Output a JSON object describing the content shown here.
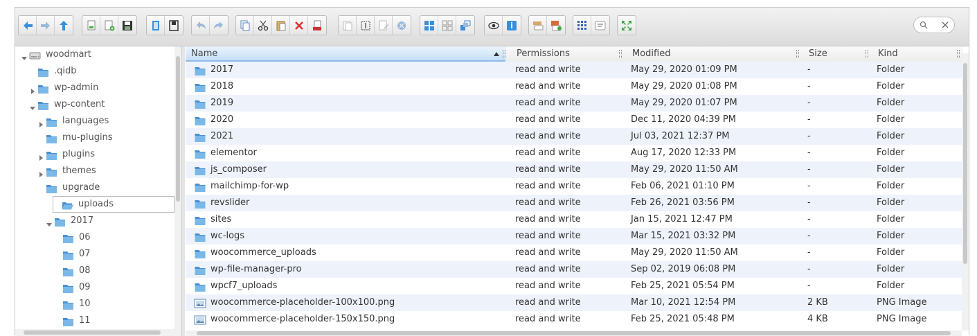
{
  "colors": {
    "folder": "#7ab8e8",
    "folder_dark": "#4a90d2",
    "accent": "#3a8fd8",
    "row_alt": "#eef3fb"
  },
  "toolbar": {
    "groups": [
      {
        "buttons": [
          "back-icon",
          "forward-icon",
          "up-icon"
        ]
      },
      {
        "buttons": [
          "reload-icon",
          "new-file-icon",
          "save-icon"
        ]
      },
      {
        "buttons": [
          "open-icon",
          "download-icon"
        ]
      },
      {
        "buttons": [
          "undo-icon",
          "redo-icon"
        ]
      },
      {
        "buttons": [
          "copy-icon",
          "cut-icon",
          "paste-icon",
          "delete-icon",
          "empty-icon"
        ]
      },
      {
        "buttons": [
          "duplicate-icon",
          "rename-icon",
          "edit-icon",
          "resize-icon"
        ]
      },
      {
        "buttons": [
          "icons-view-icon",
          "grid-view-icon",
          "list-view-icon"
        ]
      },
      {
        "buttons": [
          "preview-icon",
          "info-icon"
        ]
      },
      {
        "buttons": [
          "extract-icon",
          "archive-icon"
        ]
      },
      {
        "buttons": [
          "sort-icon",
          "help-icon"
        ]
      },
      {
        "buttons": [
          "fullscreen-icon"
        ]
      }
    ],
    "search": {
      "placeholder": ""
    }
  },
  "tree": {
    "items": [
      {
        "label": "woodmart",
        "level": 0,
        "arrow": "down",
        "icon": "drive-icon"
      },
      {
        "label": ".qidb",
        "level": 1,
        "arrow": "none",
        "icon": "folder-icon"
      },
      {
        "label": "wp-admin",
        "level": 1,
        "arrow": "right",
        "icon": "folder-icon"
      },
      {
        "label": "wp-content",
        "level": 1,
        "arrow": "down",
        "icon": "folder-icon"
      },
      {
        "label": "languages",
        "level": 2,
        "arrow": "right",
        "icon": "folder-icon"
      },
      {
        "label": "mu-plugins",
        "level": 2,
        "arrow": "none",
        "icon": "folder-icon"
      },
      {
        "label": "plugins",
        "level": 2,
        "arrow": "right",
        "icon": "folder-icon"
      },
      {
        "label": "themes",
        "level": 2,
        "arrow": "right",
        "icon": "folder-icon"
      },
      {
        "label": "upgrade",
        "level": 2,
        "arrow": "none",
        "icon": "folder-icon"
      },
      {
        "label": "uploads",
        "level": 2,
        "arrow": "none",
        "icon": "folder-open-icon",
        "selected": true
      },
      {
        "label": "2017",
        "level": 3,
        "arrow": "down",
        "icon": "folder-icon"
      },
      {
        "label": "06",
        "level": 4,
        "arrow": "none",
        "icon": "folder-icon"
      },
      {
        "label": "07",
        "level": 4,
        "arrow": "none",
        "icon": "folder-icon"
      },
      {
        "label": "08",
        "level": 4,
        "arrow": "none",
        "icon": "folder-icon"
      },
      {
        "label": "09",
        "level": 4,
        "arrow": "none",
        "icon": "folder-icon"
      },
      {
        "label": "10",
        "level": 4,
        "arrow": "none",
        "icon": "folder-icon"
      },
      {
        "label": "11",
        "level": 4,
        "arrow": "none",
        "icon": "folder-icon"
      }
    ]
  },
  "list": {
    "columns": {
      "name": "Name",
      "permissions": "Permissions",
      "modified": "Modified",
      "size": "Size",
      "kind": "Kind"
    },
    "rows": [
      {
        "name": "2017",
        "permissions": "read and write",
        "modified": "May 29, 2020 01:09 PM",
        "size": "-",
        "kind": "Folder",
        "icon": "folder-icon"
      },
      {
        "name": "2018",
        "permissions": "read and write",
        "modified": "May 29, 2020 01:08 PM",
        "size": "-",
        "kind": "Folder",
        "icon": "folder-icon"
      },
      {
        "name": "2019",
        "permissions": "read and write",
        "modified": "May 29, 2020 01:07 PM",
        "size": "-",
        "kind": "Folder",
        "icon": "folder-icon"
      },
      {
        "name": "2020",
        "permissions": "read and write",
        "modified": "Dec 11, 2020 04:39 PM",
        "size": "-",
        "kind": "Folder",
        "icon": "folder-icon"
      },
      {
        "name": "2021",
        "permissions": "read and write",
        "modified": "Jul 03, 2021 12:37 PM",
        "size": "-",
        "kind": "Folder",
        "icon": "folder-icon"
      },
      {
        "name": "elementor",
        "permissions": "read and write",
        "modified": "Aug 17, 2020 12:33 PM",
        "size": "-",
        "kind": "Folder",
        "icon": "folder-icon"
      },
      {
        "name": "js_composer",
        "permissions": "read and write",
        "modified": "May 29, 2020 11:50 AM",
        "size": "-",
        "kind": "Folder",
        "icon": "folder-icon"
      },
      {
        "name": "mailchimp-for-wp",
        "permissions": "read and write",
        "modified": "Feb 06, 2021 01:10 PM",
        "size": "-",
        "kind": "Folder",
        "icon": "folder-icon"
      },
      {
        "name": "revslider",
        "permissions": "read and write",
        "modified": "Feb 26, 2021 03:56 PM",
        "size": "-",
        "kind": "Folder",
        "icon": "folder-icon"
      },
      {
        "name": "sites",
        "permissions": "read and write",
        "modified": "Jan 15, 2021 12:47 PM",
        "size": "-",
        "kind": "Folder",
        "icon": "folder-icon"
      },
      {
        "name": "wc-logs",
        "permissions": "read and write",
        "modified": "Mar 15, 2021 03:32 PM",
        "size": "-",
        "kind": "Folder",
        "icon": "folder-icon"
      },
      {
        "name": "woocommerce_uploads",
        "permissions": "read and write",
        "modified": "May 29, 2020 11:50 AM",
        "size": "-",
        "kind": "Folder",
        "icon": "folder-icon"
      },
      {
        "name": "wp-file-manager-pro",
        "permissions": "read and write",
        "modified": "Sep 02, 2019 06:08 PM",
        "size": "-",
        "kind": "Folder",
        "icon": "folder-icon"
      },
      {
        "name": "wpcf7_uploads",
        "permissions": "read and write",
        "modified": "Feb 25, 2021 05:54 PM",
        "size": "-",
        "kind": "Folder",
        "icon": "folder-icon"
      },
      {
        "name": "woocommerce-placeholder-100x100.png",
        "permissions": "read and write",
        "modified": "Mar 10, 2021 12:54 PM",
        "size": "2 KB",
        "kind": "PNG Image",
        "icon": "image-file-icon"
      },
      {
        "name": "woocommerce-placeholder-150x150.png",
        "permissions": "read and write",
        "modified": "Feb 25, 2021 05:48 PM",
        "size": "4 KB",
        "kind": "PNG Image",
        "icon": "image-file-icon"
      }
    ]
  }
}
